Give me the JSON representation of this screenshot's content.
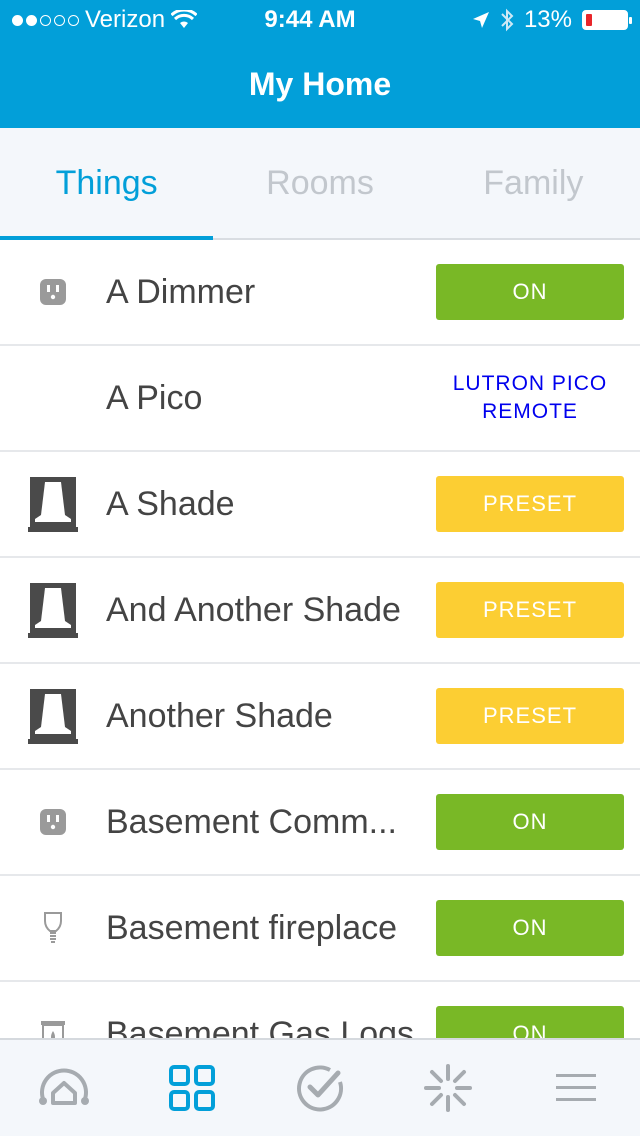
{
  "status": {
    "carrier": "Verizon",
    "time": "9:44 AM",
    "battery": "13%"
  },
  "header": {
    "title": "My Home"
  },
  "tabs": [
    {
      "label": "Things",
      "active": true
    },
    {
      "label": "Rooms",
      "active": false
    },
    {
      "label": "Family",
      "active": false
    }
  ],
  "devices": [
    {
      "name": "A Dimmer",
      "icon": "outlet-icon",
      "action": "ON",
      "action_type": "on"
    },
    {
      "name": "A Pico",
      "icon": "",
      "action": "LUTRON PICO REMOTE",
      "action_type": "text"
    },
    {
      "name": "A Shade",
      "icon": "shade-icon",
      "action": "PRESET",
      "action_type": "preset"
    },
    {
      "name": "And Another Shade",
      "icon": "shade-icon",
      "action": "PRESET",
      "action_type": "preset"
    },
    {
      "name": "Another Shade",
      "icon": "shade-icon",
      "action": "PRESET",
      "action_type": "preset"
    },
    {
      "name": "Basement Comm...",
      "icon": "outlet-icon",
      "action": "ON",
      "action_type": "on"
    },
    {
      "name": "Basement fireplace",
      "icon": "bulb-icon",
      "action": "ON",
      "action_type": "on"
    },
    {
      "name": "Basement Gas Logs",
      "icon": "fireplace-icon",
      "action": "ON",
      "action_type": "on"
    }
  ],
  "bottom_tabs": [
    {
      "icon": "home-dashboard-icon",
      "active": false
    },
    {
      "icon": "things-grid-icon",
      "active": true
    },
    {
      "icon": "check-circle-icon",
      "active": false
    },
    {
      "icon": "sparkle-icon",
      "active": false
    },
    {
      "icon": "menu-icon",
      "active": false
    }
  ],
  "colors": {
    "brand": "#029fd9",
    "on": "#79b826",
    "preset": "#fcce33"
  }
}
